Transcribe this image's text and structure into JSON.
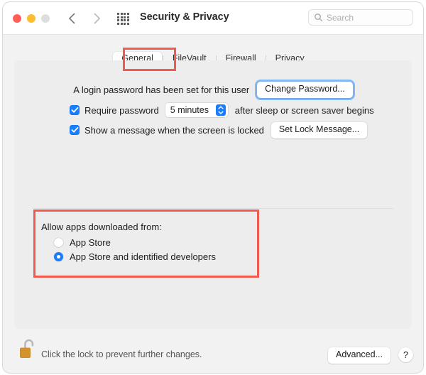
{
  "window": {
    "title": "Security & Privacy",
    "traffic_lights": [
      "close",
      "minimize",
      "zoom"
    ],
    "back_label": "Back",
    "forward_label": "Forward",
    "grid_label": "Show All"
  },
  "search": {
    "placeholder": "Search",
    "value": ""
  },
  "tabs": [
    {
      "label": "General",
      "active": true
    },
    {
      "label": "FileVault",
      "active": false
    },
    {
      "label": "Firewall",
      "active": false
    },
    {
      "label": "Privacy",
      "active": false
    }
  ],
  "general": {
    "password_status": "A login password has been set for this user",
    "change_password_button": "Change Password...",
    "require_password": {
      "checked": true,
      "label": "Require password",
      "interval_value": "5 minutes",
      "suffix": "after sleep or screen saver begins"
    },
    "lock_message": {
      "checked": true,
      "label": "Show a message when the screen is locked",
      "button": "Set Lock Message..."
    },
    "allow_apps": {
      "title": "Allow apps downloaded from:",
      "options": [
        {
          "label": "App Store",
          "selected": false
        },
        {
          "label": "App Store and identified developers",
          "selected": true
        }
      ]
    }
  },
  "footer": {
    "lock_state": "unlocked",
    "lock_hint": "Click the lock to prevent further changes.",
    "advanced_button": "Advanced...",
    "help_button": "?"
  },
  "annotations": {
    "accent_color": "#f05a50",
    "highlight_tab": "General",
    "highlight_section": "Allow apps downloaded from:"
  },
  "colors": {
    "accent_blue": "#1a7dfb",
    "annotation_red": "#f05a50",
    "window_bg": "#f2f2f2",
    "panel_bg": "#ededed",
    "lock_gold": "#d99a2b"
  }
}
